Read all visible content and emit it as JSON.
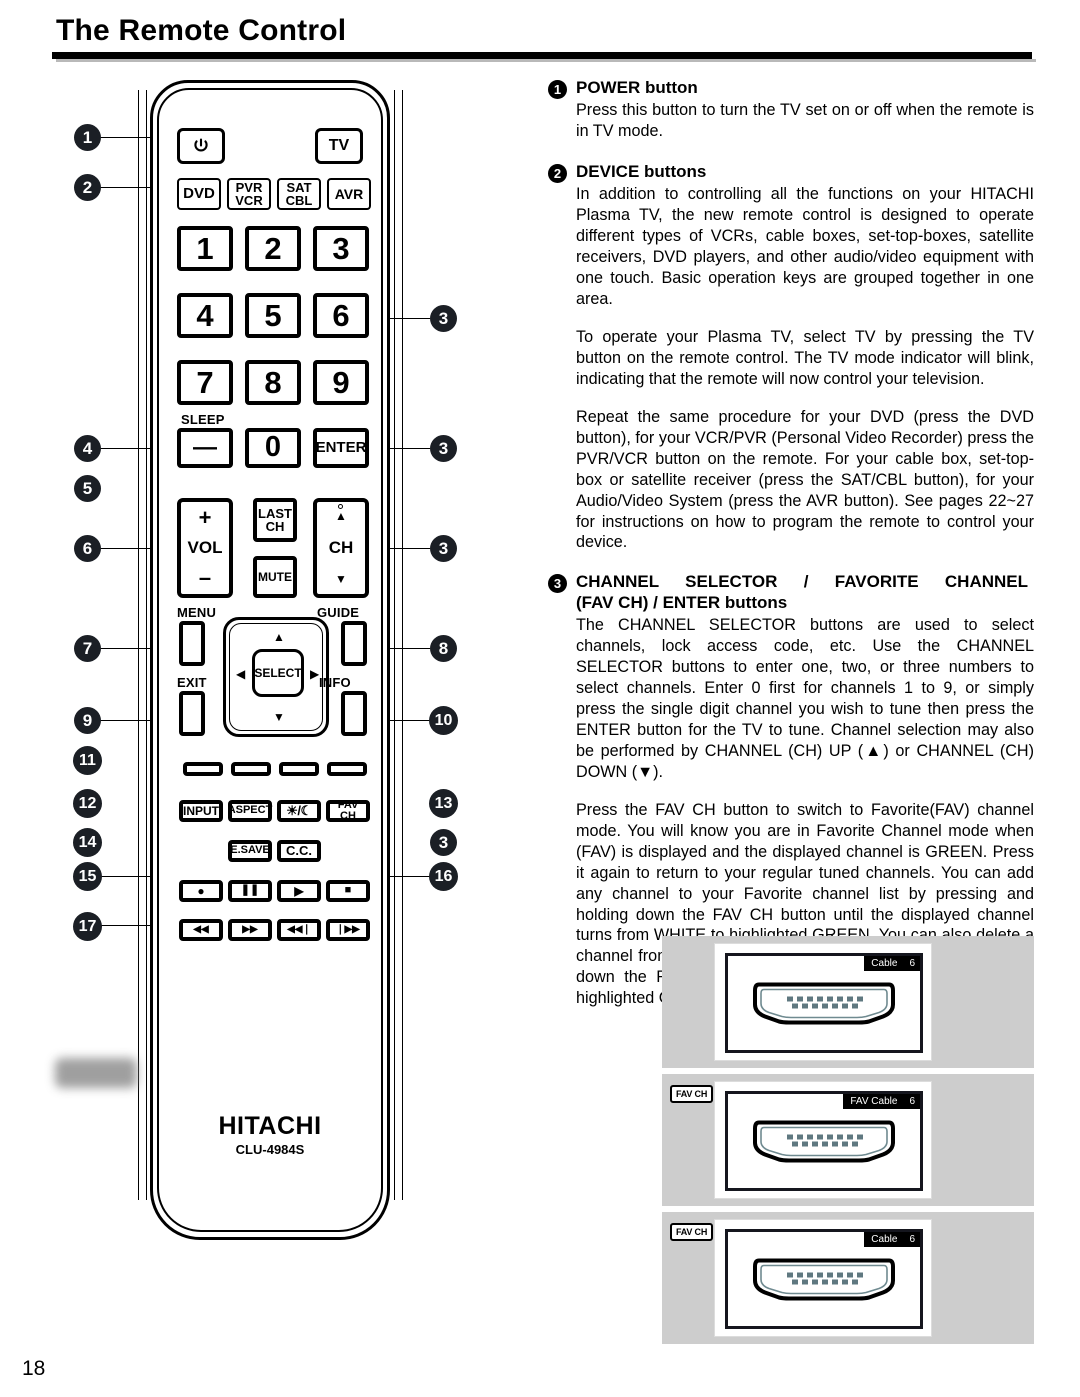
{
  "page": {
    "title": "The Remote Control",
    "number": "18"
  },
  "remote": {
    "brand": "HITACHI",
    "model": "CLU-4984S",
    "buttons": {
      "power_icon": "power-icon",
      "tv": "TV",
      "dvd": "DVD",
      "pvr_vcr": [
        "PVR",
        "VCR"
      ],
      "sat_cbl": [
        "SAT",
        "CBL"
      ],
      "avr": "AVR",
      "digits": [
        "1",
        "2",
        "3",
        "4",
        "5",
        "6",
        "7",
        "8",
        "9"
      ],
      "sleep_label": "SLEEP",
      "sleep_dash": "—",
      "zero": "0",
      "enter": "ENTER",
      "vol_plus": "+",
      "vol": "VOL",
      "vol_minus": "–",
      "last_ch": [
        "LAST",
        "CH"
      ],
      "mute": "MUTE",
      "ch_up": "▲",
      "ch": "CH",
      "ch_down": "▼",
      "menu_label": "MENU",
      "guide_label": "GUIDE",
      "exit_label": "EXIT",
      "info_label": "INFO",
      "select": "SELECT",
      "nav_up": "▲",
      "nav_down": "▼",
      "nav_left": "◀",
      "nav_right": "▶",
      "input": "INPUT",
      "aspect": "ASPECT",
      "brightness": "☀/☾",
      "fav_ch": "FAV CH",
      "esave": "E.SAVE",
      "cc": "C.C.",
      "record": "●",
      "pause": "❚❚",
      "play": "▶",
      "stop": "■",
      "rewind": "◀◀",
      "fastforward": "▶▶",
      "prev": "◀◀❘",
      "next": "❘▶▶"
    },
    "callouts_left": [
      "1",
      "2",
      "4",
      "5",
      "6",
      "7",
      "9",
      "11",
      "12",
      "14",
      "15",
      "17"
    ],
    "callouts_right": [
      "3",
      "3",
      "3",
      "8",
      "10",
      "13",
      "3",
      "16"
    ]
  },
  "sections": [
    {
      "number": "1",
      "heading": "POWER button",
      "paragraphs": [
        "Press this button to turn the TV set on or off when the remote is in TV mode."
      ]
    },
    {
      "number": "2",
      "heading": "DEVICE buttons",
      "paragraphs": [
        "In addition to controlling all the functions on your HITACHI Plasma TV, the new remote control is designed to operate different types of VCRs, cable boxes, set-top-boxes, satellite receivers, DVD players, and other audio/video equipment with one touch. Basic operation keys are grouped together in one area.",
        "To operate your Plasma TV, select TV by pressing the TV button on the remote control. The TV mode indicator will blink, indicating that the remote will now control your television.",
        "Repeat the same procedure for your DVD (press the DVD button), for your VCR/PVR (Personal Video Recorder) press the PVR/VCR button on the remote. For your cable box, set-top-box or satellite receiver (press the SAT/CBL button), for your Audio/Video System (press the AVR button). See pages 22~27 for instructions on how to program the remote to control your device."
      ]
    },
    {
      "number": "3",
      "heading_line1": "CHANNEL  SELECTOR  /  FAVORITE  CHANNEL",
      "heading_line2": "(FAV CH) / ENTER buttons",
      "paragraphs": [
        "The CHANNEL SELECTOR buttons are used to select channels, lock access code, etc. Use the CHANNEL SELECTOR buttons to enter one, two, or three numbers to select channels. Enter 0 first for channels 1 to 9, or simply press the single digit channel you wish to tune then press the ENTER button for the TV to tune. Channel selection may also be performed by CHANNEL (CH) UP (▲) or CHANNEL (CH) DOWN (▼).",
        "Press the FAV CH button to switch to Favorite(FAV) channel mode. You will know you are in Favorite Channel mode when (FAV) is displayed and the displayed channel is GREEN. Press it again to return to your regular tuned channels. You can add any channel to your Favorite channel list by pressing and holding down the FAV CH button until the displayed channel turns from WHITE to highlighted GREEN. You can also delete a channel from your favorite channel list by pressing and holding down the FAV CH button until the displayed channel turns highlighted GREEN to WHITE."
      ]
    }
  ],
  "panels": [
    {
      "fav_button": "",
      "osd_label": "Cable",
      "osd_channel": "6"
    },
    {
      "fav_button": "FAV CH",
      "osd_label": "FAV Cable",
      "osd_channel": "6"
    },
    {
      "fav_button": "FAV CH",
      "osd_label": "Cable",
      "osd_channel": "6"
    }
  ]
}
